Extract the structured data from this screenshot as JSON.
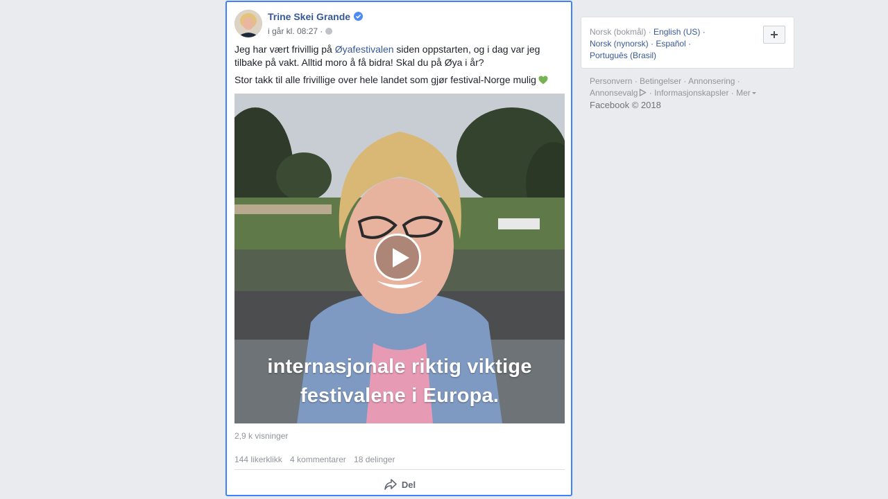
{
  "post": {
    "author": "Trine Skei Grande",
    "timestamp": "i går kl. 08:27 ·",
    "text_part1": "Jeg har vært frivillig på ",
    "text_link": "Øyafestivalen",
    "text_part2": " siden oppstarten, og i dag var jeg tilbake på vakt. Alltid moro å få bidra! Skal du på Øya i år?",
    "text_line2": "Stor takk til alle frivillige over hele landet som gjør festival-Norge mulig",
    "video": {
      "caption_line1": "internasjonale riktig viktige",
      "caption_line2": "festivalene i Europa."
    },
    "views": "2,9 k visninger",
    "likes": "144 likerklikk",
    "comments": "4 kommentarer",
    "shares": "18 delinger",
    "share_label": "Del",
    "colors": {
      "link": "#365899",
      "highlight_border": "#4080ff",
      "verified": "#4c8bf5"
    }
  },
  "languages": {
    "current": "Norsk (bokmål) ·",
    "items": [
      "English (US) ·",
      "Norsk (nynorsk) ·",
      "Español ·",
      "Português (Brasil)"
    ]
  },
  "footer": {
    "links": [
      "Personvern ·",
      "Betingelser ·",
      "Annonsering ·",
      "Annonsevalg",
      "· Informasjonskapsler ·",
      "Mer"
    ],
    "copyright": "Facebook © 2018"
  }
}
